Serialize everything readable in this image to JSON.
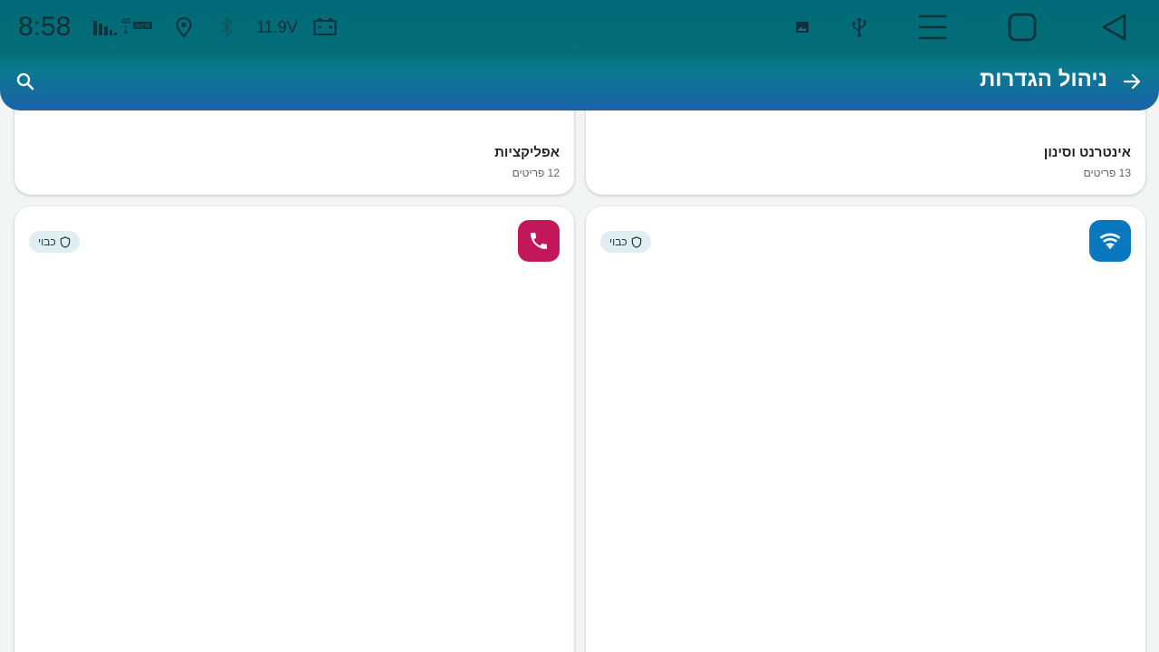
{
  "status_bar": {
    "time": "8:58",
    "voltage": "11.9V",
    "network_type": "4G",
    "network_badge": "VoLTE",
    "icons": [
      "signal-icon",
      "location-icon",
      "bluetooth-icon",
      "battery-icon",
      "image-icon",
      "usb-icon",
      "menu-icon",
      "home-icon",
      "back-nav-icon"
    ]
  },
  "toolbar": {
    "title": "ניהול הגדרות",
    "back_icon": "arrow-forward-icon",
    "search_icon": "search-icon"
  },
  "categories": [
    {
      "title": "אינטרנט וסינון",
      "count": "13 פריטים"
    },
    {
      "title": "אפליקציות",
      "count": "12 פריטים"
    },
    {
      "icon": "wifi-icon",
      "color": "#0a78be",
      "status": "כבוי"
    },
    {
      "icon": "phone-icon",
      "color": "#c2185b",
      "status": "כבוי"
    }
  ],
  "colors": {
    "appbar": "#036d79",
    "appbar_bottom": "#1c62a8",
    "background": "#f2f5f6",
    "chip": "#dfeef0"
  }
}
